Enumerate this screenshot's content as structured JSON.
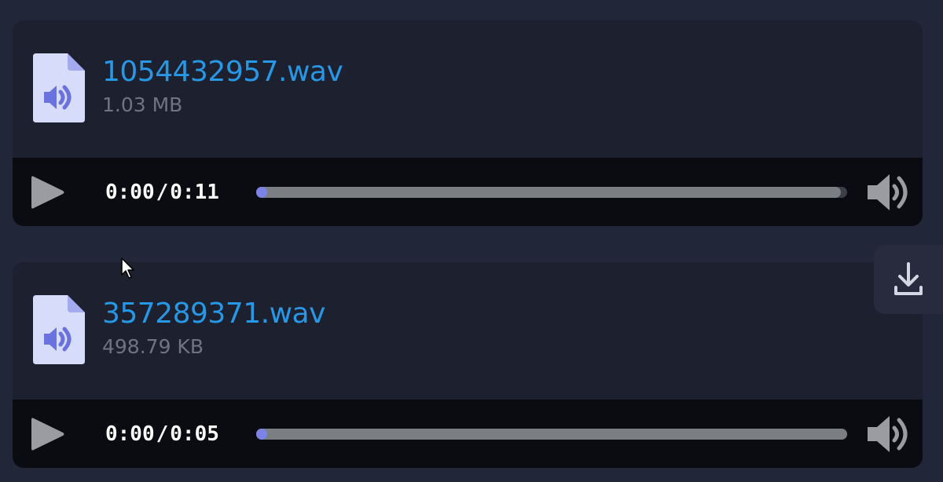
{
  "files": [
    {
      "name": "1054432957.wav",
      "size": "1.03 MB",
      "player": {
        "current_time": "0:00",
        "separator": "/",
        "duration": "0:11",
        "buffered_fraction": 0.99,
        "played_fraction": 0.0
      }
    },
    {
      "name": "357289371.wav",
      "size": "498.79 KB",
      "player": {
        "current_time": "0:00",
        "separator": "/",
        "duration": "0:05",
        "buffered_fraction": 1.0,
        "played_fraction": 0.0
      }
    }
  ],
  "icons": {
    "file": "audio-file-icon",
    "play": "play-icon",
    "volume": "volume-icon",
    "download": "download-icon"
  },
  "colors": {
    "page_background": "#222639",
    "card_background": "#1d202f",
    "player_background": "#0b0c11",
    "file_name": "#2798e6",
    "file_size": "#6f7483",
    "accent": "#7b83e6"
  }
}
